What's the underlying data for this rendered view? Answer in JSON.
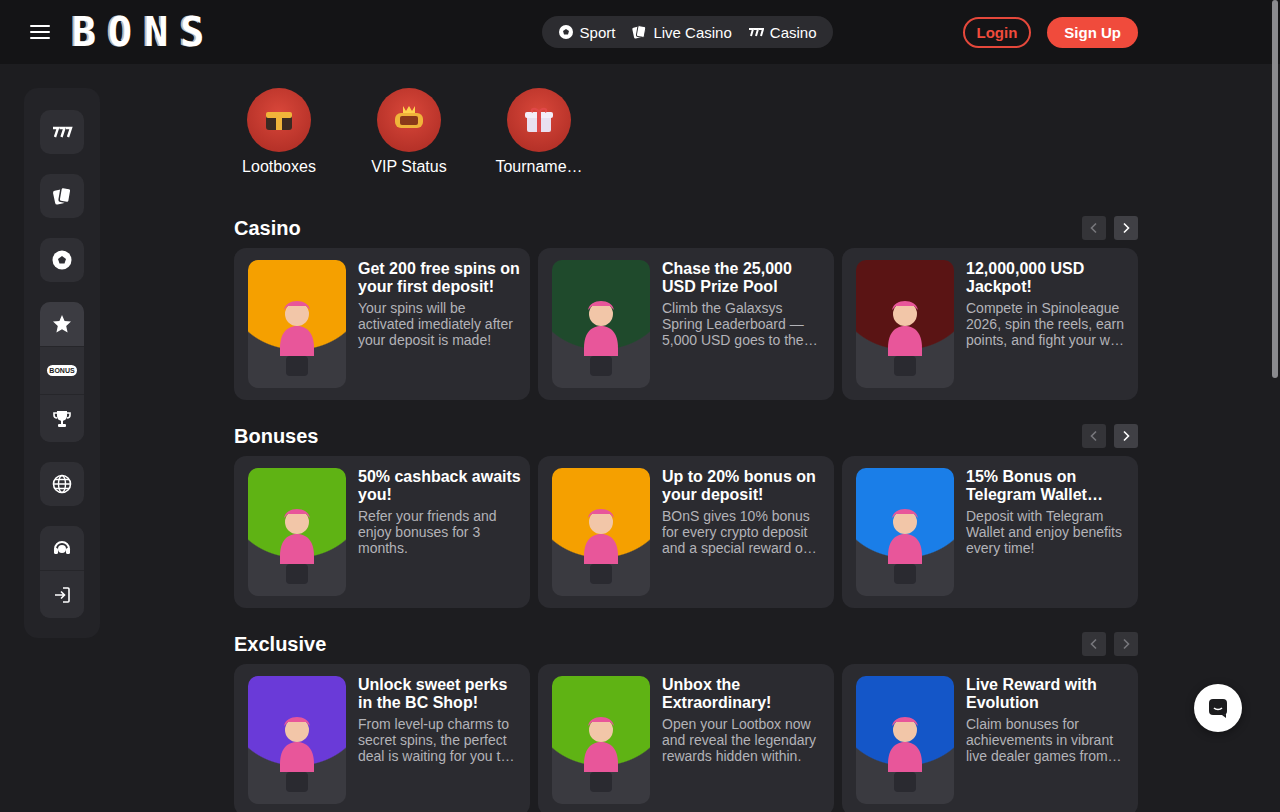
{
  "header": {
    "logo": "BONS",
    "nav": [
      {
        "label": "Sport",
        "selected": false
      },
      {
        "label": "Live Casino",
        "selected": false
      },
      {
        "label": "Casino",
        "selected": false
      }
    ],
    "login": "Login",
    "signup": "Sign Up"
  },
  "sidebar": {
    "groups": [
      {
        "items": [
          {
            "selected": false
          }
        ]
      },
      {
        "items": [
          {
            "selected": false
          }
        ]
      },
      {
        "items": [
          {
            "selected": false
          }
        ]
      },
      {
        "items": [
          {
            "selected": true
          },
          {
            "selected": false,
            "badge": "BONUS"
          },
          {
            "selected": false
          }
        ]
      },
      {
        "items": [
          {
            "selected": false
          }
        ]
      },
      {
        "items": [
          {
            "selected": false
          },
          {
            "selected": false
          }
        ]
      }
    ]
  },
  "quick_links": [
    {
      "label": "Lootboxes"
    },
    {
      "label": "VIP Status"
    },
    {
      "label": "Tourname…"
    }
  ],
  "sections": [
    {
      "title": "Casino",
      "prev_disabled": true,
      "next_disabled": false,
      "cards": [
        {
          "title": "Get 200 free spins on your first deposit!",
          "text": "Your spins will be activated imediately after your deposit is made!",
          "color": "#f5a000"
        },
        {
          "title": "Chase the 25,000 USD Prize Pool",
          "text": "Climb the Galaxsys Spring Leaderboard — 5,000 USD goes to the…",
          "color": "#1f4a2c"
        },
        {
          "title": "12,000,000 USD Jackpot!",
          "text": "Compete in Spinoleague 2026, spin the reels, earn points, and fight your w…",
          "color": "#5a1414"
        }
      ]
    },
    {
      "title": "Bonuses",
      "prev_disabled": true,
      "next_disabled": false,
      "cards": [
        {
          "title": "50% cashback awaits you!",
          "text": "Refer your friends and enjoy bonuses for 3 months.",
          "color": "#5fb314"
        },
        {
          "title": "Up to 20% bonus on your deposit!",
          "text": "BOnS gives 10% bonus for every crypto deposit and a special reward o…",
          "color": "#f5a000"
        },
        {
          "title": "15% Bonus on Telegram Wallet…",
          "text": "Deposit with Telegram Wallet and enjoy benefits every time!",
          "color": "#1a7ee8"
        }
      ]
    },
    {
      "title": "Exclusive",
      "prev_disabled": true,
      "next_disabled": true,
      "cards": [
        {
          "title": "Unlock sweet perks in the BC Shop!",
          "text": "From level-up charms to secret spins, the perfect deal is waiting for you t…",
          "color": "#6a3ad8"
        },
        {
          "title": "Unbox the Extraordinary!",
          "text": "Open your Lootbox now and reveal the legendary rewards hidden within.",
          "color": "#5fb314"
        },
        {
          "title": "Live Reward with Evolution",
          "text": "Claim bonuses for achievements in vibrant live dealer games from…",
          "color": "#1456c8"
        }
      ]
    }
  ]
}
